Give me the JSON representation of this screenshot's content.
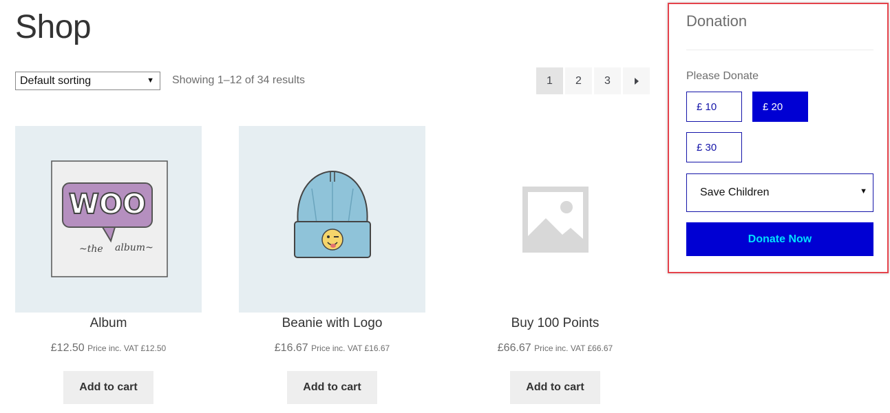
{
  "page": {
    "title": "Shop"
  },
  "toolbar": {
    "sort_value": "Default sorting",
    "result_count": "Showing 1–12 of 34 results"
  },
  "pagination": {
    "pages": [
      "1",
      "2",
      "3"
    ],
    "current": "1",
    "next_icon": "triangle-right-icon"
  },
  "products": [
    {
      "name": "Album",
      "price": "£12.50",
      "vat": "Price inc. VAT £12.50",
      "button": "Add to cart",
      "image": "woo-album-art"
    },
    {
      "name": "Beanie with Logo",
      "price": "£16.67",
      "vat": "Price inc. VAT £16.67",
      "button": "Add to cart",
      "image": "beanie-art"
    },
    {
      "name": "Buy 100 Points",
      "price": "£66.67",
      "vat": "Price inc. VAT £66.67",
      "button": "Add to cart",
      "image": "placeholder-image-icon"
    }
  ],
  "donation": {
    "title": "Donation",
    "label": "Please Donate",
    "amounts": [
      "£ 10",
      "£ 20",
      "£ 30"
    ],
    "selected_amount": "£ 20",
    "cause_value": "Save Children",
    "button": "Donate Now",
    "colors": {
      "accent": "#0000d3",
      "button_text": "#00e0ff",
      "frame": "#e5434b"
    }
  }
}
